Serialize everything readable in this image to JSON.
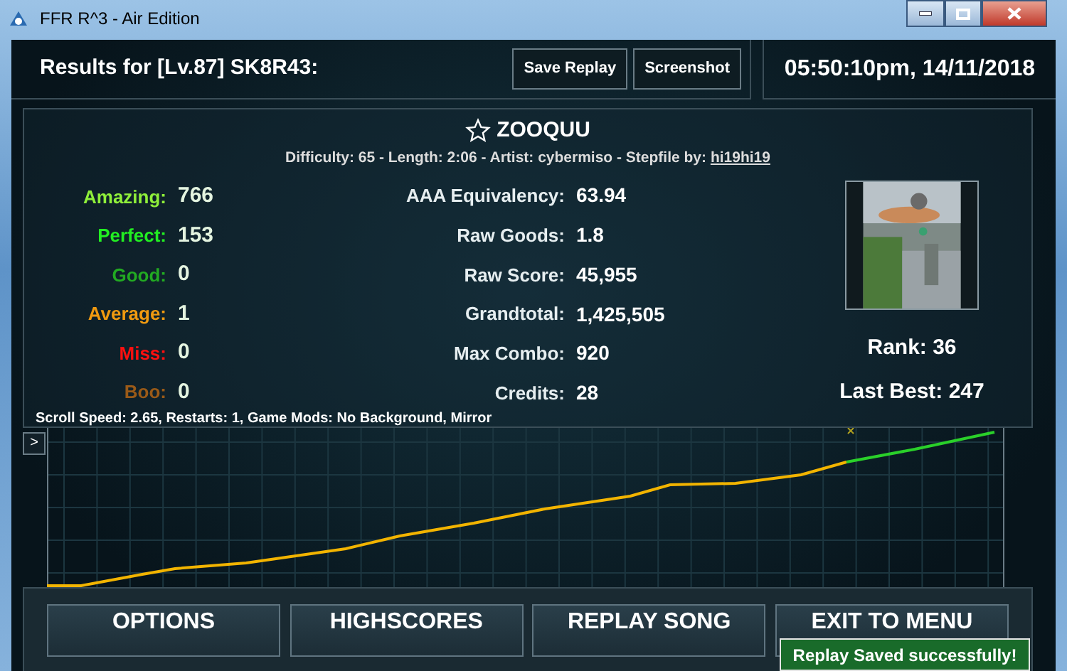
{
  "window": {
    "title": "FFR R^3 - Air Edition"
  },
  "header": {
    "title": "Results for [Lv.87] SK8R43:",
    "buttons": [
      "Save Replay",
      "Screenshot"
    ],
    "datetime": "05:50:10pm, 14/11/2018"
  },
  "song": {
    "favorite": false,
    "title": "ZOOQUU",
    "details": "Difficulty: 65 - Length: 2:06 - Artist: cybermiso - Stepfile by:",
    "stepfile_author": "hi19hi19"
  },
  "judgements": [
    {
      "label": "Amazing:",
      "value": "766",
      "color": "#8fef3a"
    },
    {
      "label": "Perfect:",
      "value": "153",
      "color": "#22ee22"
    },
    {
      "label": "Good:",
      "value": "0",
      "color": "#22aa22"
    },
    {
      "label": "Average:",
      "value": "1",
      "color": "#f09a10"
    },
    {
      "label": "Miss:",
      "value": "0",
      "color": "#ff1010"
    },
    {
      "label": "Boo:",
      "value": "0",
      "color": "#9a5a18"
    }
  ],
  "stats": [
    {
      "label": "AAA Equivalency:",
      "value": "63.94"
    },
    {
      "label": "Raw Goods:",
      "value": "1.8"
    },
    {
      "label": "Raw Score:",
      "value": "45,955"
    },
    {
      "label": "Grandtotal:",
      "value": "1,425,505"
    },
    {
      "label": "Max Combo:",
      "value": "920"
    },
    {
      "label": "Credits:",
      "value": "28"
    }
  ],
  "rank": "Rank: 36",
  "last_best": "Last Best: 247",
  "settings": "Scroll Speed: 2.65, Restarts: 1, Game Mods: No Background, Mirror",
  "graph": {
    "expand_button": ">"
  },
  "buttons": [
    "OPTIONS",
    "HIGHSCORES",
    "REPLAY SONG",
    "EXIT TO MENU"
  ],
  "toast": "Replay Saved successfully!"
}
